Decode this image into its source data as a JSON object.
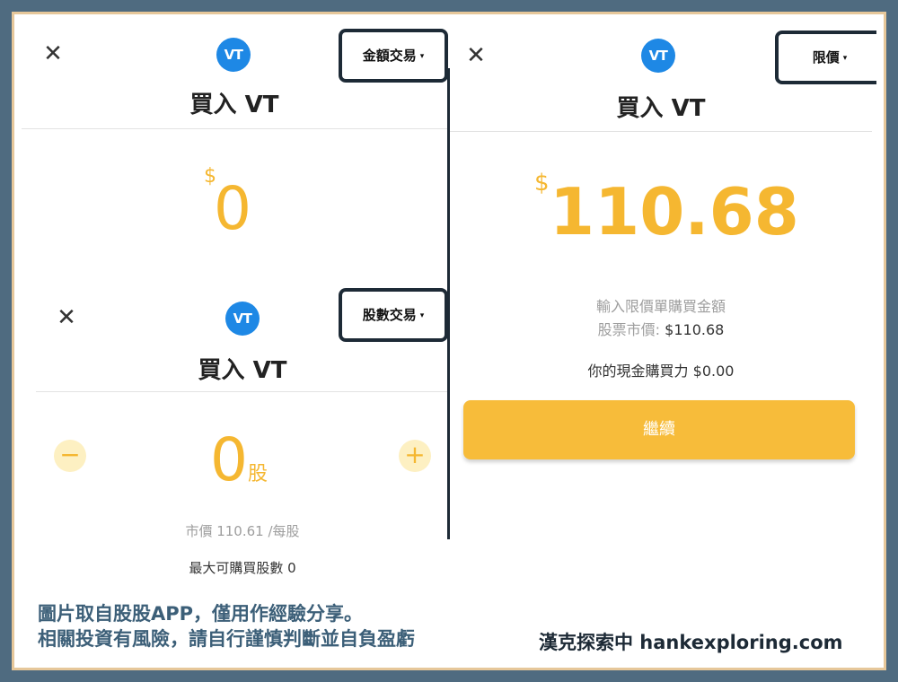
{
  "left_top": {
    "close_glyph": "✕",
    "logo_text": "VT",
    "mode_label": "金額交易",
    "mode_caret": "▾",
    "title": "買入 VT",
    "currency": "$",
    "amount": "0"
  },
  "left_bottom": {
    "close_glyph": "✕",
    "logo_text": "VT",
    "mode_label": "股數交易",
    "mode_caret": "▾",
    "title": "買入 VT",
    "minus_glyph": "−",
    "plus_glyph": "+",
    "shares": "0",
    "shares_unit": "股",
    "market_price": "市價 110.61 /每股",
    "max_shares": "最大可購買股數 0"
  },
  "right": {
    "close_glyph": "✕",
    "logo_text": "VT",
    "mode_label": "限價",
    "mode_caret": "▾",
    "title": "買入 VT",
    "currency": "$",
    "amount": "110.68",
    "hint": "輸入限價單購買金額",
    "market_label": "股票市價: ",
    "market_value": "$110.68",
    "buying_power": "你的現金購買力 $0.00",
    "continue_label": "繼續"
  },
  "footer": {
    "line1": "圖片取自股股APP，僅用作經驗分享。",
    "line2": "相關投資有風險，請自行謹慎判斷並自負盈虧",
    "brand": "漢克探索中 hankexploring.com"
  },
  "colors": {
    "accent": "#f5b731",
    "logo_blue": "#1e88e5",
    "frame": "#4f6b80",
    "border_gold": "#e6c79a",
    "highlight_box": "#1d2a36"
  }
}
